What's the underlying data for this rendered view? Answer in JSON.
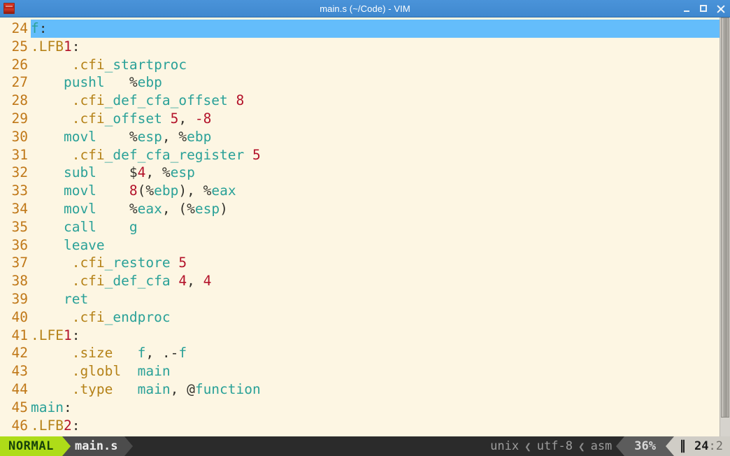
{
  "window": {
    "title": "main.s (~/Code) - VIM",
    "icon": "vim-terminal-icon",
    "controls": {
      "minimize": "minimize-icon",
      "maximize": "maximize-icon",
      "close": "close-icon"
    }
  },
  "editor": {
    "first_visible_line": 24,
    "lines": [
      {
        "no": "24",
        "cursor": true,
        "tokens": [
          {
            "t": "f",
            "c": "label"
          },
          {
            "t": ":",
            "c": "punct"
          }
        ]
      },
      {
        "no": "25",
        "cursor": false,
        "tokens": [
          {
            "t": ".LFB",
            "c": "dir"
          },
          {
            "t": "1",
            "c": "num"
          },
          {
            "t": ":",
            "c": "punct"
          }
        ]
      },
      {
        "no": "26",
        "cursor": false,
        "tokens": [
          {
            "t": "     .cfi",
            "c": "dir"
          },
          {
            "t": "_startproc",
            "c": "instr"
          }
        ]
      },
      {
        "no": "27",
        "cursor": false,
        "tokens": [
          {
            "t": "    pushl   ",
            "c": "instr"
          },
          {
            "t": "%",
            "c": "punct"
          },
          {
            "t": "ebp",
            "c": "reg"
          }
        ]
      },
      {
        "no": "28",
        "cursor": false,
        "tokens": [
          {
            "t": "     .cfi",
            "c": "dir"
          },
          {
            "t": "_def_cfa_offset ",
            "c": "instr"
          },
          {
            "t": "8",
            "c": "num"
          }
        ]
      },
      {
        "no": "29",
        "cursor": false,
        "tokens": [
          {
            "t": "     .cfi",
            "c": "dir"
          },
          {
            "t": "_offset ",
            "c": "instr"
          },
          {
            "t": "5",
            "c": "num"
          },
          {
            "t": ", ",
            "c": "punct"
          },
          {
            "t": "-8",
            "c": "num"
          }
        ]
      },
      {
        "no": "30",
        "cursor": false,
        "tokens": [
          {
            "t": "    movl    ",
            "c": "instr"
          },
          {
            "t": "%",
            "c": "punct"
          },
          {
            "t": "esp",
            "c": "reg"
          },
          {
            "t": ", ",
            "c": "punct"
          },
          {
            "t": "%",
            "c": "punct"
          },
          {
            "t": "ebp",
            "c": "reg"
          }
        ]
      },
      {
        "no": "31",
        "cursor": false,
        "tokens": [
          {
            "t": "     .cfi",
            "c": "dir"
          },
          {
            "t": "_def_cfa_register ",
            "c": "instr"
          },
          {
            "t": "5",
            "c": "num"
          }
        ]
      },
      {
        "no": "32",
        "cursor": false,
        "tokens": [
          {
            "t": "    subl    ",
            "c": "instr"
          },
          {
            "t": "$",
            "c": "punct"
          },
          {
            "t": "4",
            "c": "num"
          },
          {
            "t": ", ",
            "c": "punct"
          },
          {
            "t": "%",
            "c": "punct"
          },
          {
            "t": "esp",
            "c": "reg"
          }
        ]
      },
      {
        "no": "33",
        "cursor": false,
        "tokens": [
          {
            "t": "    movl    ",
            "c": "instr"
          },
          {
            "t": "8",
            "c": "num"
          },
          {
            "t": "(",
            "c": "punct"
          },
          {
            "t": "%",
            "c": "punct"
          },
          {
            "t": "ebp",
            "c": "reg"
          },
          {
            "t": "), ",
            "c": "punct"
          },
          {
            "t": "%",
            "c": "punct"
          },
          {
            "t": "eax",
            "c": "reg"
          }
        ]
      },
      {
        "no": "34",
        "cursor": false,
        "tokens": [
          {
            "t": "    movl    ",
            "c": "instr"
          },
          {
            "t": "%",
            "c": "punct"
          },
          {
            "t": "eax",
            "c": "reg"
          },
          {
            "t": ", (",
            "c": "punct"
          },
          {
            "t": "%",
            "c": "punct"
          },
          {
            "t": "esp",
            "c": "reg"
          },
          {
            "t": ")",
            "c": "punct"
          }
        ]
      },
      {
        "no": "35",
        "cursor": false,
        "tokens": [
          {
            "t": "    call    ",
            "c": "instr"
          },
          {
            "t": "g",
            "c": "ident"
          }
        ]
      },
      {
        "no": "36",
        "cursor": false,
        "tokens": [
          {
            "t": "    leave",
            "c": "instr"
          }
        ]
      },
      {
        "no": "37",
        "cursor": false,
        "tokens": [
          {
            "t": "     .cfi",
            "c": "dir"
          },
          {
            "t": "_restore ",
            "c": "instr"
          },
          {
            "t": "5",
            "c": "num"
          }
        ]
      },
      {
        "no": "38",
        "cursor": false,
        "tokens": [
          {
            "t": "     .cfi",
            "c": "dir"
          },
          {
            "t": "_def_cfa ",
            "c": "instr"
          },
          {
            "t": "4",
            "c": "num"
          },
          {
            "t": ", ",
            "c": "punct"
          },
          {
            "t": "4",
            "c": "num"
          }
        ]
      },
      {
        "no": "39",
        "cursor": false,
        "tokens": [
          {
            "t": "    ret",
            "c": "instr"
          }
        ]
      },
      {
        "no": "40",
        "cursor": false,
        "tokens": [
          {
            "t": "     .cfi",
            "c": "dir"
          },
          {
            "t": "_endproc",
            "c": "instr"
          }
        ]
      },
      {
        "no": "41",
        "cursor": false,
        "tokens": [
          {
            "t": ".LFE",
            "c": "dir"
          },
          {
            "t": "1",
            "c": "num"
          },
          {
            "t": ":",
            "c": "punct"
          }
        ]
      },
      {
        "no": "42",
        "cursor": false,
        "tokens": [
          {
            "t": "     .size   ",
            "c": "dir"
          },
          {
            "t": "f",
            "c": "ident"
          },
          {
            "t": ", ",
            "c": "punct"
          },
          {
            "t": ".-",
            "c": "punct"
          },
          {
            "t": "f",
            "c": "ident"
          }
        ]
      },
      {
        "no": "43",
        "cursor": false,
        "tokens": [
          {
            "t": "     .globl  ",
            "c": "dir"
          },
          {
            "t": "main",
            "c": "ident"
          }
        ]
      },
      {
        "no": "44",
        "cursor": false,
        "tokens": [
          {
            "t": "     .type   ",
            "c": "dir"
          },
          {
            "t": "main",
            "c": "ident"
          },
          {
            "t": ", ",
            "c": "punct"
          },
          {
            "t": "@",
            "c": "punct"
          },
          {
            "t": "function",
            "c": "ident"
          }
        ]
      },
      {
        "no": "45",
        "cursor": false,
        "tokens": [
          {
            "t": "main",
            "c": "label"
          },
          {
            "t": ":",
            "c": "punct"
          }
        ]
      },
      {
        "no": "46",
        "cursor": false,
        "tokens": [
          {
            "t": ".LFB",
            "c": "dir"
          },
          {
            "t": "2",
            "c": "num"
          },
          {
            "t": ":",
            "c": "punct"
          }
        ]
      }
    ]
  },
  "statusline": {
    "mode": "NORMAL",
    "filename": "main.s",
    "fileformat": "unix",
    "encoding": "utf-8",
    "filetype": "asm",
    "percent": "36%",
    "position_glyph": "line-column-icon",
    "line": "24",
    "colon": ":",
    "column": "2",
    "separator_chevron": "❮",
    "separator_arrow_left": "◀"
  },
  "scrollbar": {
    "name": "vertical-scrollbar"
  },
  "colors": {
    "background": "#fdf6e3",
    "cursorline": "#64bdfb",
    "lineno": "#c07818",
    "directive": "#b58218",
    "instruction": "#2aa198",
    "number": "#b3122a",
    "punct": "#33322c",
    "titlebar": "#458ed4",
    "mode_badge": "#aedc18",
    "statusbar": "#2b2b2b"
  }
}
